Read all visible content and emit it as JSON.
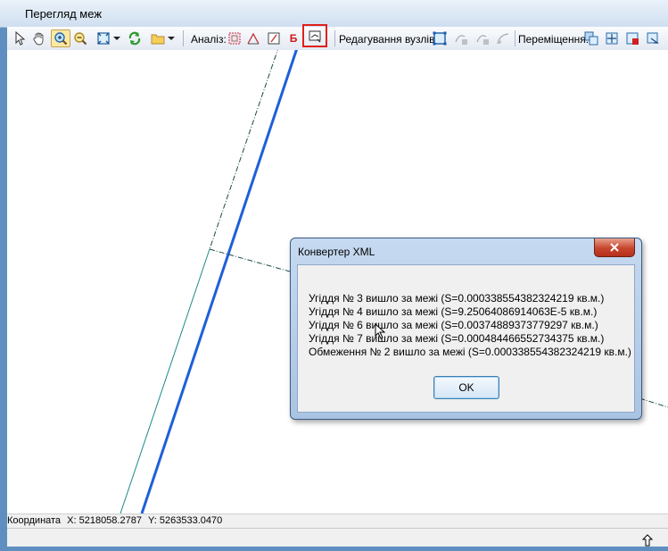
{
  "window": {
    "title": "Перегляд меж"
  },
  "toolbar": {
    "analysis_label": "Аналіз:",
    "b_button": "Б",
    "edit_nodes_label": "Редагування вузлів:",
    "move_label": "Переміщення:"
  },
  "status": {
    "coord_label": "Координата",
    "x_label": "X:",
    "x_value": "5218058.2787",
    "y_label": "Y:",
    "y_value": "5263533.0470"
  },
  "dialog": {
    "title": "Конвертер XML",
    "messages": [
      "Угіддя № 3 вишло за межі (S=0.000338554382324219 кв.м.)",
      "Угіддя № 4 вишло за межі (S=9.25064086914063E-5 кв.м.)",
      "Угіддя № 6 вишло за межі (S=0.00374889373779297 кв.м.)",
      "Угіддя № 7 вишло за межі (S=0.000484466552734375 кв.м.)",
      "Обмеження № 2 вишло за межі (S=0.000338554382324219 кв.м.)"
    ],
    "ok_label": "OK"
  },
  "colors": {
    "accent_highlight": "#e0201c",
    "boundary_line": "#1f5fd8",
    "parcel_line": "#1a8a8a"
  }
}
